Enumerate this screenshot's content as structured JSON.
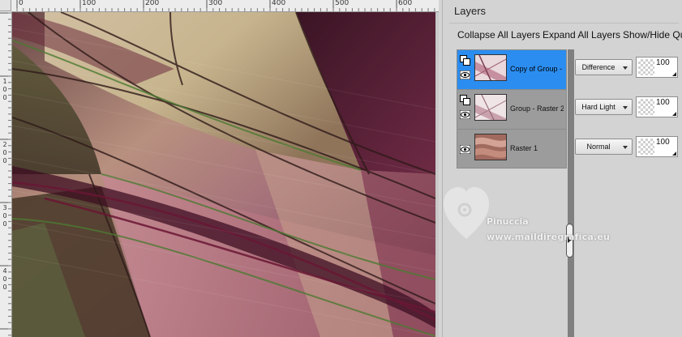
{
  "ruler": {
    "h_labels": [
      "0",
      "100",
      "200",
      "300",
      "400",
      "500",
      "600"
    ],
    "v_labels": [
      "1\n0\n0",
      "2\n0\n0",
      "3\n0\n0",
      "4\n0\n0"
    ]
  },
  "layers_panel": {
    "title": "Layers",
    "toolbar": {
      "collapse_all": "Collapse All Layers",
      "expand_all": "Expand All Layers",
      "show_hide": "Show/Hide Qu"
    },
    "layers": [
      {
        "name": "Copy of Group - R",
        "blend_mode": "Difference",
        "opacity": "100",
        "selected": true
      },
      {
        "name": "Group - Raster 2",
        "blend_mode": "Hard Light",
        "opacity": "100",
        "selected": false
      },
      {
        "name": "Raster 1",
        "blend_mode": "Normal",
        "opacity": "100",
        "selected": false
      }
    ],
    "accent_color": "#2b8df0"
  },
  "watermark": {
    "name": "Pinuccia",
    "url": "www.maildiregrafica.eu"
  }
}
